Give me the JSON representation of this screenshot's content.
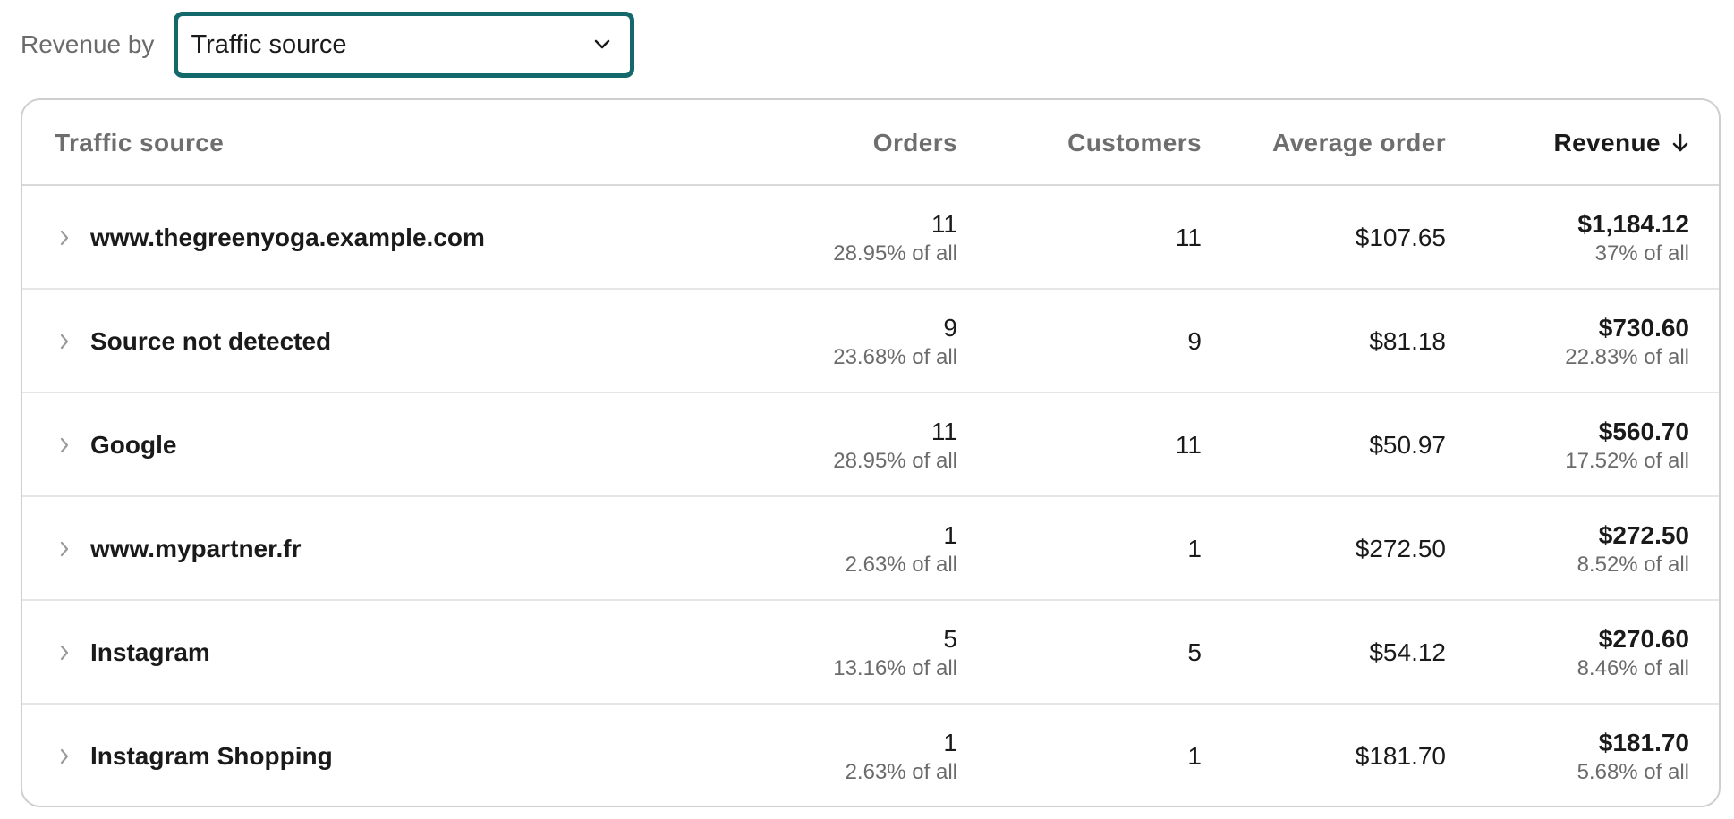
{
  "toolbar": {
    "label": "Revenue by",
    "select_value": "Traffic source"
  },
  "table": {
    "headers": {
      "name": "Traffic source",
      "orders": "Orders",
      "customers": "Customers",
      "average_order": "Average order",
      "revenue": "Revenue"
    },
    "sort": {
      "column": "revenue",
      "direction": "desc"
    },
    "rows": [
      {
        "name": "www.thegreenyoga.example.com",
        "orders": "11",
        "orders_pct": "28.95% of all",
        "customers": "11",
        "average_order": "$107.65",
        "revenue": "$1,184.12",
        "revenue_pct": "37% of all"
      },
      {
        "name": "Source not detected",
        "orders": "9",
        "orders_pct": "23.68% of all",
        "customers": "9",
        "average_order": "$81.18",
        "revenue": "$730.60",
        "revenue_pct": "22.83% of all"
      },
      {
        "name": "Google",
        "orders": "11",
        "orders_pct": "28.95% of all",
        "customers": "11",
        "average_order": "$50.97",
        "revenue": "$560.70",
        "revenue_pct": "17.52% of all"
      },
      {
        "name": "www.mypartner.fr",
        "orders": "1",
        "orders_pct": "2.63% of all",
        "customers": "1",
        "average_order": "$272.50",
        "revenue": "$272.50",
        "revenue_pct": "8.52% of all"
      },
      {
        "name": "Instagram",
        "orders": "5",
        "orders_pct": "13.16% of all",
        "customers": "5",
        "average_order": "$54.12",
        "revenue": "$270.60",
        "revenue_pct": "8.46% of all"
      },
      {
        "name": "Instagram Shopping",
        "orders": "1",
        "orders_pct": "2.63% of all",
        "customers": "1",
        "average_order": "$181.70",
        "revenue": "$181.70",
        "revenue_pct": "5.68% of all"
      }
    ]
  },
  "colors": {
    "select_border": "#12686a",
    "muted_text": "#6b6b6b",
    "table_border": "#cfcfcf"
  },
  "icons": {
    "select_chevron": "chevron-down-icon",
    "row_expander": "chevron-right-icon",
    "sort_indicator": "arrow-down-icon"
  }
}
